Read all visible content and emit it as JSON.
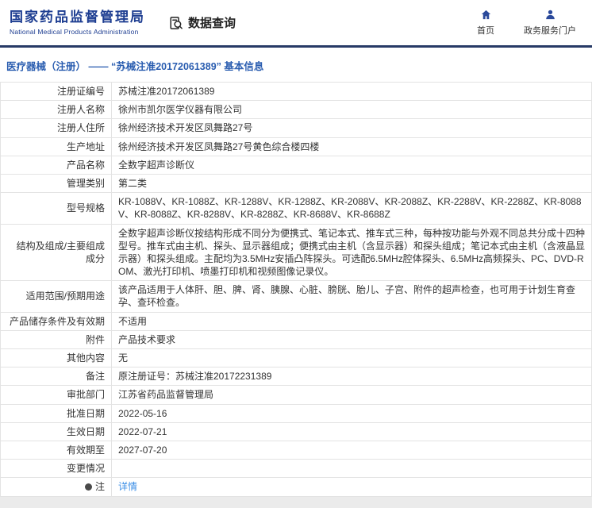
{
  "header": {
    "brand_cn": "国家药品监督管理局",
    "brand_en": "National Medical Products Administration",
    "section_title": "数据查询",
    "nav": [
      {
        "label": "首页",
        "icon": "home-icon"
      },
      {
        "label": "政务服务门户",
        "icon": "user-icon"
      }
    ]
  },
  "colors": {
    "brand_blue": "#1d3d91",
    "divider_navy": "#273a66",
    "breadcrumb_blue": "#2a5db0",
    "link_blue": "#3a8ee6",
    "border_gray": "#e3e3e3"
  },
  "breadcrumb": "医疗器械（注册） —— “苏械注准20172061389” 基本信息",
  "table": {
    "rows": [
      {
        "label": "注册证编号",
        "value": "苏械注准20172061389"
      },
      {
        "label": "注册人名称",
        "value": "徐州市凯尔医学仪器有限公司"
      },
      {
        "label": "注册人住所",
        "value": "徐州经济技术开发区凤舞路27号"
      },
      {
        "label": "生产地址",
        "value": "徐州经济技术开发区凤舞路27号黄色综合楼四楼"
      },
      {
        "label": "产品名称",
        "value": "全数字超声诊断仪"
      },
      {
        "label": "管理类别",
        "value": "第二类"
      },
      {
        "label": "型号规格",
        "value": "KR-1088V、KR-1088Z、KR-1288V、KR-1288Z、KR-2088V、KR-2088Z、KR-2288V、KR-2288Z、KR-8088V、KR-8088Z、KR-8288V、KR-8288Z、KR-8688V、KR-8688Z"
      },
      {
        "label": "结构及组成/主要组成成分",
        "value": "全数字超声诊断仪按结构形成不同分为便携式、笔记本式、推车式三种，每种按功能与外观不同总共分成十四种型号。推车式由主机、探头、显示器组成；便携式由主机（含显示器）和探头组成；笔记本式由主机（含液晶显示器）和探头组成。主配均为3.5MHz安插凸阵探头。可选配6.5MHz腔体探头、6.5MHz高频探头、PC、DVD-ROM、激光打印机、喷墨打印机和视频图像记录仪。"
      },
      {
        "label": "适用范围/预期用途",
        "value": "该产品适用于人体肝、胆、脾、肾、胰腺、心脏、膀胱、胎儿、子宫、附件的超声检查，也可用于计划生育查孕、查环检查。"
      },
      {
        "label": "产品储存条件及有效期",
        "value": "不适用"
      },
      {
        "label": "附件",
        "value": "产品技术要求"
      },
      {
        "label": "其他内容",
        "value": "无"
      },
      {
        "label": "备注",
        "value": "原注册证号：苏械注准20172231389"
      },
      {
        "label": "审批部门",
        "value": "江苏省药品监督管理局"
      },
      {
        "label": "批准日期",
        "value": "2022-05-16"
      },
      {
        "label": "生效日期",
        "value": "2022-07-21"
      },
      {
        "label": "有效期至",
        "value": "2027-07-20"
      },
      {
        "label": "变更情况",
        "value": ""
      },
      {
        "label": "注",
        "value": "详情",
        "link": true,
        "icon": true
      }
    ]
  }
}
